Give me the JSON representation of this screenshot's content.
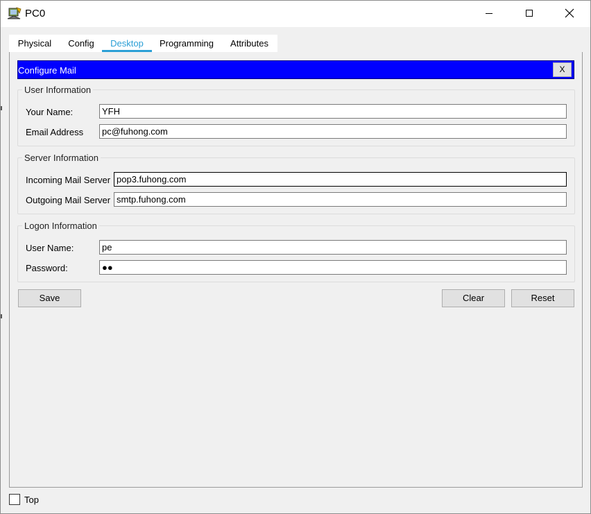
{
  "window": {
    "title": "PC0",
    "controls": [
      "minimize-icon",
      "maximize-icon",
      "close-icon"
    ]
  },
  "tabs": [
    {
      "label": "Physical",
      "active": false
    },
    {
      "label": "Config",
      "active": false
    },
    {
      "label": "Desktop",
      "active": true
    },
    {
      "label": "Programming",
      "active": false
    },
    {
      "label": "Attributes",
      "active": false
    }
  ],
  "accent_color": "#2a9fd6",
  "mail": {
    "header_title": "Configure Mail",
    "header_color": "#0000ff",
    "close_label": "X",
    "user_info": {
      "legend": "User Information",
      "your_name_label": "Your Name:",
      "your_name_value": "YFH",
      "email_label": "Email Address",
      "email_value": "pc@fuhong.com"
    },
    "server_info": {
      "legend": "Server Information",
      "incoming_label": "Incoming Mail Server",
      "incoming_value": "pop3.fuhong.com",
      "outgoing_label": "Outgoing Mail Server",
      "outgoing_value": "smtp.fuhong.com"
    },
    "logon_info": {
      "legend": "Logon Information",
      "user_label": "User Name:",
      "user_value": "pe",
      "password_label": "Password:",
      "password_value": "●●"
    },
    "buttons": {
      "save": "Save",
      "clear": "Clear",
      "reset": "Reset"
    }
  },
  "footer": {
    "top_label": "Top",
    "top_checked": false
  }
}
